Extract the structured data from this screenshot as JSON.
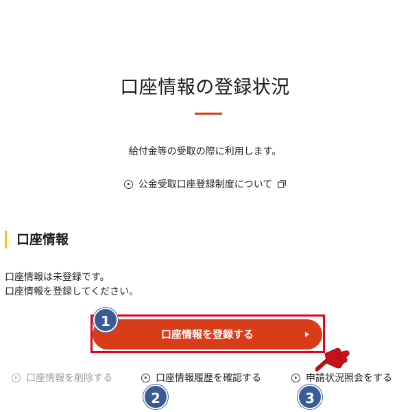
{
  "page": {
    "title": "口座情報の登録状況",
    "intro": "給付金等の受取の際に利用します。",
    "about_link": "公金受取口座登録制度について"
  },
  "section": {
    "heading": "口座情報",
    "status_line1": "口座情報は未登録です。",
    "status_line2": "口座情報を登録してください。"
  },
  "register_button": {
    "label": "口座情報を登録する"
  },
  "actions": {
    "delete": "口座情報を削除する",
    "history": "口座情報履歴を確認する",
    "inquiry": "申請状況照会をする"
  },
  "badges": {
    "one": "1",
    "two": "2",
    "three": "3"
  },
  "colors": {
    "accent_red": "#d93c19",
    "highlight_red": "#e60012",
    "heading_bar_yellow": "#f0c419",
    "badge_blue": "#3a5b95"
  }
}
